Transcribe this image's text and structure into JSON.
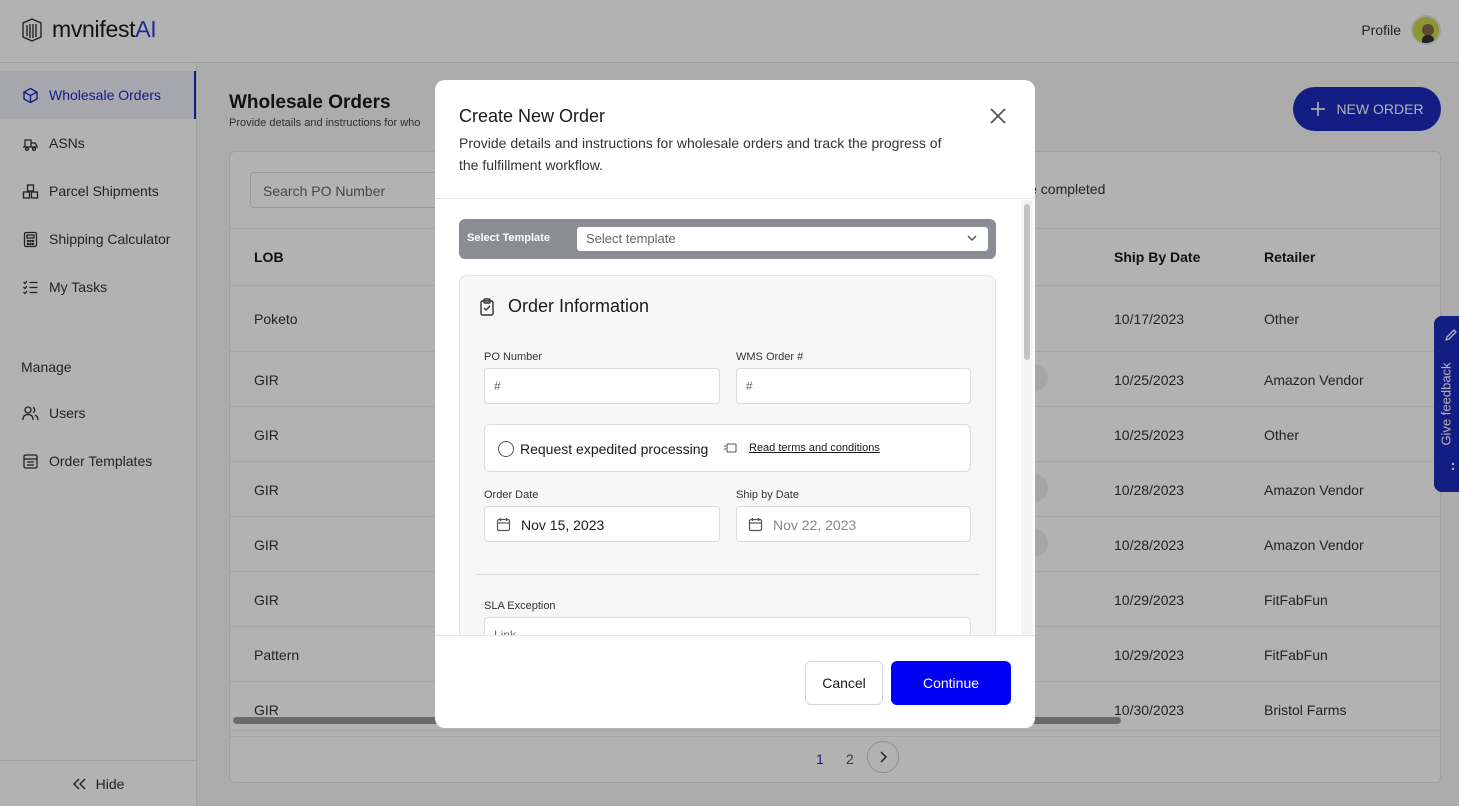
{
  "app": {
    "logo_main": "mvnifest",
    "logo_accent": "AI",
    "profile_label": "Profile"
  },
  "sidebar": {
    "items": [
      {
        "label": "Wholesale Orders",
        "icon": "cube-icon",
        "active": true
      },
      {
        "label": "ASNs",
        "icon": "truck-icon"
      },
      {
        "label": "Parcel Shipments",
        "icon": "boxes-icon"
      },
      {
        "label": "Shipping Calculator",
        "icon": "calculator-icon"
      },
      {
        "label": "My Tasks",
        "icon": "checklist-icon"
      }
    ],
    "section_label": "Manage",
    "manage_items": [
      {
        "label": "Users",
        "icon": "users-icon"
      },
      {
        "label": "Order Templates",
        "icon": "template-icon"
      }
    ],
    "hide_label": "Hide"
  },
  "main": {
    "title": "Wholesale Orders",
    "subtitle": "Provide details and instructions for who",
    "new_order_label": "NEW ORDER",
    "search_placeholder": "Search PO Number",
    "filter_text": "le completed",
    "columns": {
      "lob": "LOB",
      "ship_by": "Ship By Date",
      "retailer": "Retailer"
    },
    "rows": [
      {
        "lob": "Poketo",
        "ship_by": "10/17/2023",
        "retailer": "Other"
      },
      {
        "lob": "GIR",
        "ship_by": "10/25/2023",
        "retailer": "Amazon Vendor"
      },
      {
        "lob": "GIR",
        "ship_by": "10/25/2023",
        "retailer": "Other"
      },
      {
        "lob": "GIR",
        "ship_by": "10/28/2023",
        "retailer": "Amazon Vendor"
      },
      {
        "lob": "GIR",
        "ship_by": "10/28/2023",
        "retailer": "Amazon Vendor"
      },
      {
        "lob": "GIR",
        "ship_by": "10/29/2023",
        "retailer": "FitFabFun"
      },
      {
        "lob": "Pattern",
        "ship_by": "10/29/2023",
        "retailer": "FitFabFun"
      },
      {
        "lob": "GIR",
        "ship_by": "10/30/2023",
        "retailer": "Bristol Farms"
      }
    ],
    "pagination": {
      "page1": "1",
      "page2": "2"
    }
  },
  "feedback": {
    "label": "Give feedback"
  },
  "modal": {
    "title": "Create New Order",
    "subtitle": "Provide details and instructions for wholesale orders and track the progress of the fulfillment workflow.",
    "template_label": "Select Template",
    "template_placeholder": "Select template",
    "section_title": "Order Information",
    "po_label": "PO Number",
    "po_placeholder": "#",
    "wms_label": "WMS Order #",
    "wms_placeholder": "#",
    "expedite_label": "Request expedited processing",
    "terms_link": "Read terms and conditions",
    "order_date_label": "Order Date",
    "order_date_value": "Nov 15, 2023",
    "ship_date_label": "Ship by Date",
    "ship_date_value": "Nov 22, 2023",
    "sla_label": "SLA Exception",
    "sla_placeholder": "Link",
    "cancel_label": "Cancel",
    "continue_label": "Continue"
  },
  "colors": {
    "brand": "#1c2bbf",
    "primary_button": "#0000f5"
  }
}
